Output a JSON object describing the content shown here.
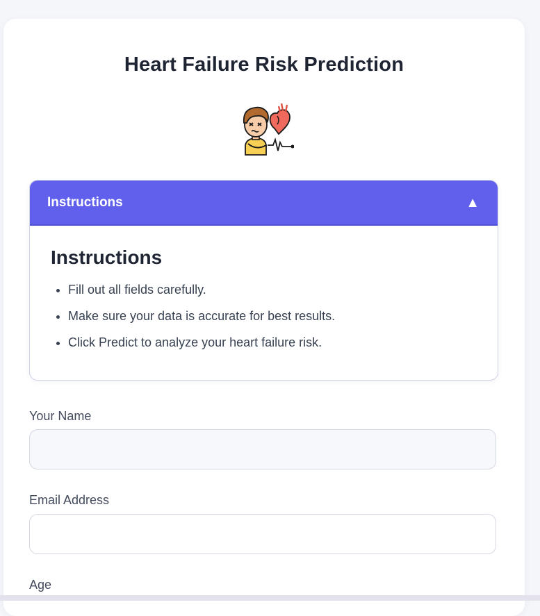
{
  "page": {
    "title": "Heart Failure Risk Prediction",
    "mascot_icon": "sick-person-heart-icon"
  },
  "instructions": {
    "header_label": "Instructions",
    "toggle_icon": "▲",
    "heading": "Instructions",
    "items": [
      "Fill out all fields carefully.",
      "Make sure your data is accurate for best results.",
      "Click Predict to analyze your heart failure risk."
    ]
  },
  "form": {
    "name": {
      "label": "Your Name",
      "value": "",
      "placeholder": ""
    },
    "email": {
      "label": "Email Address",
      "value": "",
      "placeholder": ""
    },
    "age": {
      "label": "Age"
    }
  },
  "colors": {
    "accent": "#6060ec",
    "background": "#f5f6fa",
    "card": "#ffffff"
  }
}
